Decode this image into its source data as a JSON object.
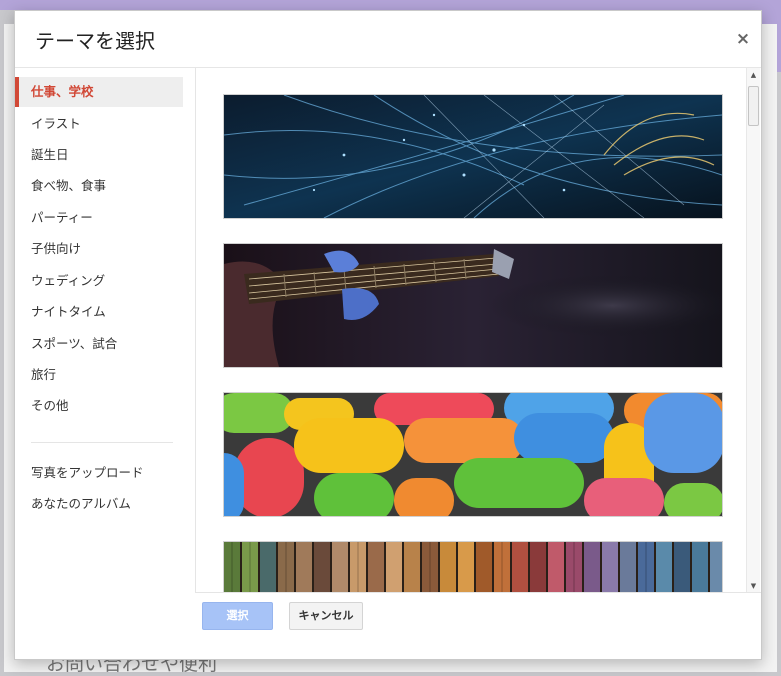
{
  "dialog": {
    "title": "テーマを選択",
    "close_label": "×"
  },
  "sidebar": {
    "categories": [
      {
        "label": "仕事、学校",
        "active": true
      },
      {
        "label": "イラスト"
      },
      {
        "label": "誕生日"
      },
      {
        "label": "食べ物、食事"
      },
      {
        "label": "パーティー"
      },
      {
        "label": "子供向け"
      },
      {
        "label": "ウェディング"
      },
      {
        "label": "ナイトタイム"
      },
      {
        "label": "スポーツ、試合"
      },
      {
        "label": "旅行"
      },
      {
        "label": "その他"
      }
    ],
    "upload": {
      "label": "写真をアップロード"
    },
    "album": {
      "label": "あなたのアルバム"
    }
  },
  "themes": [
    {
      "icon": "fiber-optic-lights-image"
    },
    {
      "icon": "electric-guitar-image"
    },
    {
      "icon": "colorful-candy-image"
    },
    {
      "icon": "colored-yarn-threads-image"
    }
  ],
  "footer": {
    "select_label": "選択",
    "cancel_label": "キャンセル"
  },
  "background": {
    "partial_text": "お問い合わせや便利"
  },
  "colors": {
    "accent": "#d14836",
    "primary_button": "#a7c3f7",
    "header_bar": "#b3a4d8"
  }
}
